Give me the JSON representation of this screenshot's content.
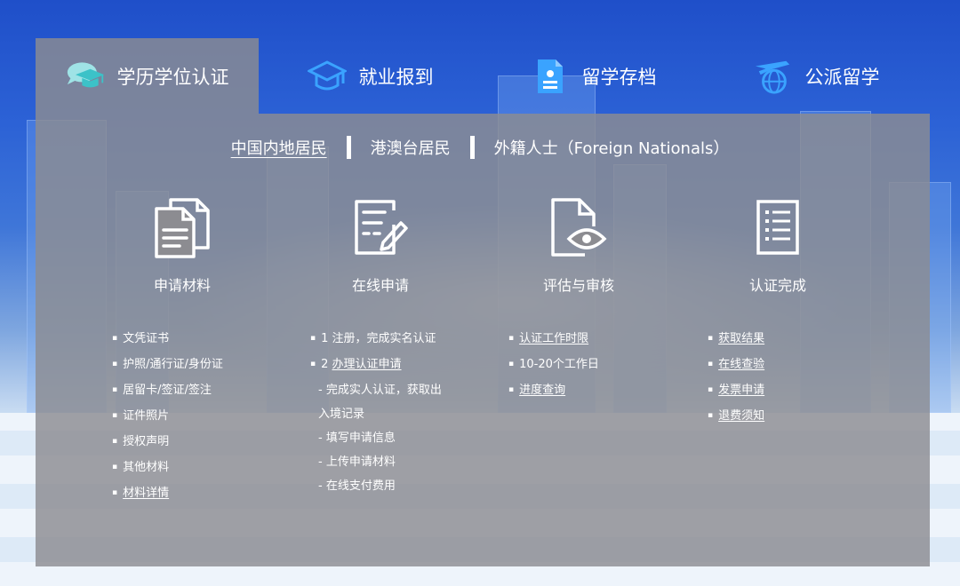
{
  "tabs": [
    {
      "label": "学历学位认证",
      "icon": "graduation-cap-bubble-icon",
      "active": true
    },
    {
      "label": "就业报到",
      "icon": "mortarboard-icon",
      "active": false
    },
    {
      "label": "留学存档",
      "icon": "archive-folder-icon",
      "active": false
    },
    {
      "label": "公派留学",
      "icon": "airplane-globe-icon",
      "active": false
    }
  ],
  "subnav": {
    "items": [
      "中国内地居民",
      "港澳台居民",
      "外籍人士（Foreign Nationals）"
    ],
    "selected": "中国内地居民"
  },
  "steps": [
    {
      "title": "申请材料",
      "icon": "documents-icon"
    },
    {
      "title": "在线申请",
      "icon": "form-edit-icon"
    },
    {
      "title": "评估与审核",
      "icon": "document-eye-icon"
    },
    {
      "title": "认证完成",
      "icon": "checklist-icon"
    }
  ],
  "lists": {
    "materials": [
      "文凭证书",
      "护照/通行证/身份证",
      "居留卡/签证/签注",
      "证件照片",
      "授权声明",
      "其他材料"
    ],
    "materials_link": "材料详情",
    "apply": {
      "step1": "1 注册，完成实名认证",
      "step2_prefix": "2 ",
      "step2_link": "办理认证申请",
      "subs": [
        "- 完成实人认证，获取出",
        "入境记录",
        "- 填写申请信息",
        "- 上传申请材料",
        "- 在线支付费用"
      ]
    },
    "review": {
      "link1": "认证工作时限",
      "text": "10-20个工作日",
      "link2": "进度查询"
    },
    "done": [
      "获取结果",
      "在线查验",
      "发票申请",
      "退费须知"
    ]
  },
  "colors": {
    "accent_blue": "#2b6fe0",
    "teal": "#3cc2c8",
    "panel": "#8c8c91"
  }
}
